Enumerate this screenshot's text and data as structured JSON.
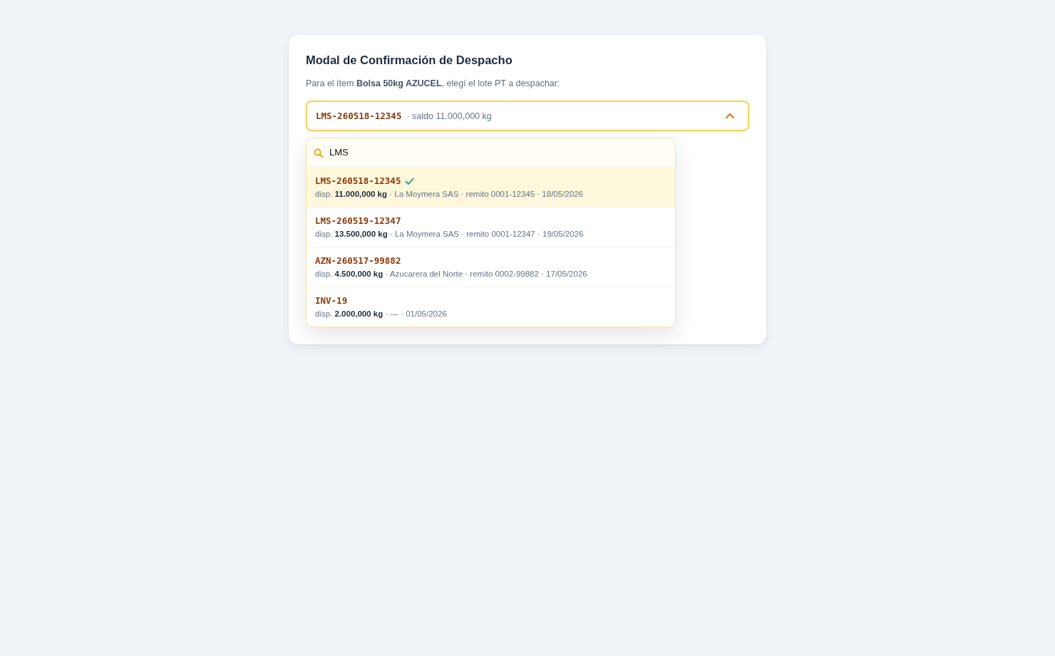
{
  "modal": {
    "title": "Modal de Confirmación de Despacho",
    "prompt": "Para el ítem **Bolsa 50kg AZUCEL**, elegí el lote PT a despachar:"
  },
  "lot_select": {
    "value_code": "LMS-260518-12345",
    "value_detail": "· saldo 11.000,000 kg",
    "expanded": true
  },
  "dropdown": {
    "search": {
      "value": "LMS"
    },
    "options": [
      {
        "code": "LMS-260518-12345",
        "selected": true,
        "meta": "disp. **11.000,000 kg** · La Moymera SAS · remito 0001-12345 · 18/05/2026"
      },
      {
        "code": "LMS-260519-12347",
        "selected": false,
        "meta": "disp. **13.500,000 kg** · La Moymera SAS · remito 0001-12347 · 19/05/2026"
      },
      {
        "code": "AZN-260517-99882",
        "selected": false,
        "meta": "disp. **4.500,000 kg** · Azucarera del Norte · remito 0002-99882 · 17/05/2026"
      },
      {
        "code": "INV-19",
        "selected": false,
        "meta": "disp. **2.000,000 kg** · — · 01/05/2026"
      }
    ]
  }
}
